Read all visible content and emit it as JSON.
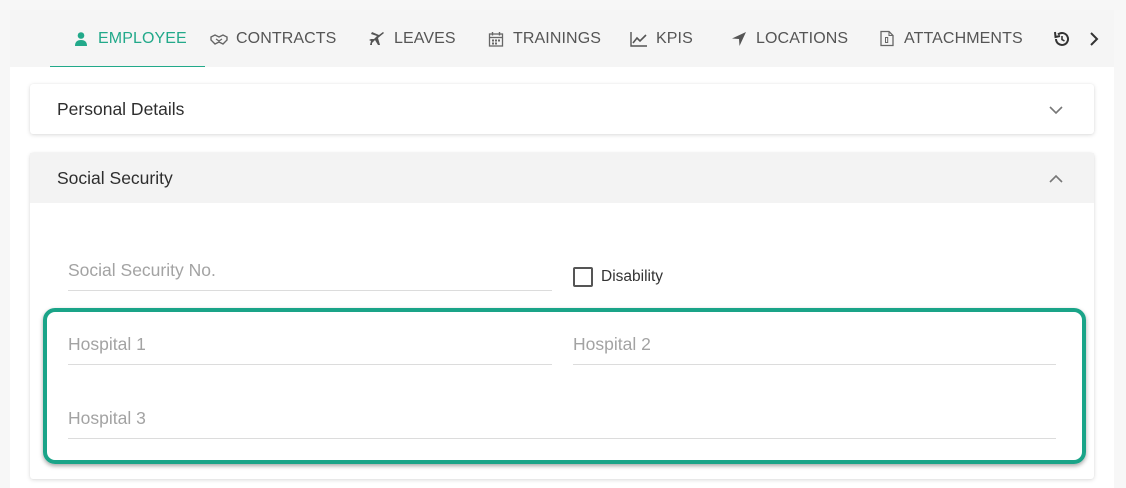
{
  "tabs": [
    {
      "label": "EMPLOYEE",
      "icon": "user-icon",
      "active": true
    },
    {
      "label": "CONTRACTS",
      "icon": "handshake-icon",
      "active": false
    },
    {
      "label": "LEAVES",
      "icon": "plane-icon",
      "active": false
    },
    {
      "label": "TRAININGS",
      "icon": "calendar-icon",
      "active": false
    },
    {
      "label": "KPIS",
      "icon": "line-chart-icon",
      "active": false
    },
    {
      "label": "LOCATIONS",
      "icon": "location-arrow-icon",
      "active": false
    },
    {
      "label": "ATTACHMENTS",
      "icon": "file-icon",
      "active": false
    }
  ],
  "colors": {
    "accent": "#22a98a",
    "highlight_border": "#1aa488"
  },
  "sections": {
    "personal_details": {
      "title": "Personal Details",
      "expanded": false
    },
    "social_security": {
      "title": "Social Security",
      "expanded": true,
      "ssn_placeholder": "Social Security No.",
      "ssn_value": "",
      "disability_label": "Disability",
      "disability_checked": false,
      "hospital1_placeholder": "Hospital 1",
      "hospital2_placeholder": "Hospital 2",
      "hospital3_placeholder": "Hospital 3"
    }
  }
}
